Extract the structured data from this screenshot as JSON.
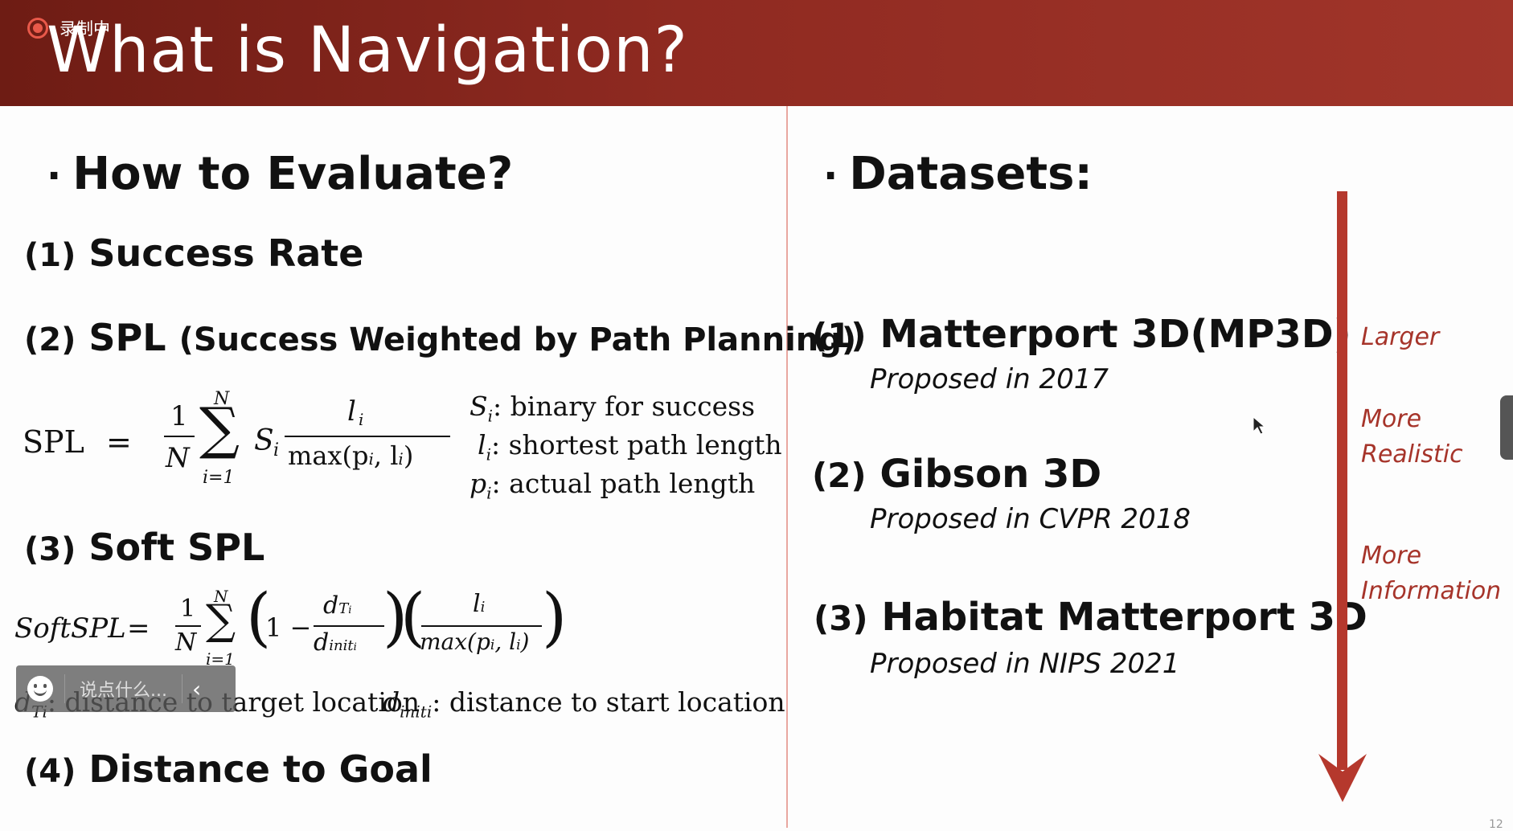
{
  "recording": {
    "label": "录制中"
  },
  "slide": {
    "title": "What is Navigation?",
    "left": {
      "heading": "How to Evaluate?",
      "items": [
        {
          "num": "(1)",
          "label": "Success Rate"
        },
        {
          "num": "(2)",
          "label": "SPL",
          "sub": "(Success Weighted by Path Planning)"
        },
        {
          "num": "(3)",
          "label": "Soft SPL"
        },
        {
          "num": "(4)",
          "label": "Distance to Goal"
        }
      ],
      "spl_formula": {
        "lhs": "SPL",
        "eq": "=",
        "one": "1",
        "N": "N",
        "sum_top": "N",
        "sum_bottom": "i=1",
        "S": "S",
        "i": "i",
        "num": "l",
        "den": "max(p",
        "den2": ", l",
        "den3": ")"
      },
      "spl_legend": [
        {
          "sym": "S",
          "sub": "i",
          "text": ": binary for success"
        },
        {
          "sym": "l",
          "sub": "i",
          "text": ": shortest path length"
        },
        {
          "sym": "p",
          "sub": "i",
          "text": ": actual path length"
        }
      ],
      "softspl_formula": {
        "lhs": "SoftSPL",
        "eq": "=",
        "one": "1",
        "N": "N",
        "sum_top": "N",
        "sum_bottom": "i=1",
        "minus": "1 −",
        "d_top": "d",
        "d_top_sub": "T",
        "d_top_subsub": "i",
        "d_bot": "d",
        "d_bot_sub": "init",
        "d_bot_subsub": "i",
        "l": "l",
        "l_sub": "i",
        "max": "max(p",
        "max2": ", l",
        "max3": ")"
      },
      "softspl_legend": [
        {
          "sym": "d",
          "sub": "Ti",
          "text": ": distance to target location"
        },
        {
          "sym": "d",
          "sub": "initi",
          "text": ": distance to start location"
        }
      ]
    },
    "right": {
      "heading": "Datasets:",
      "datasets": [
        {
          "num": "(1)",
          "name": "Matterport 3D(MP3D)",
          "sub": "Proposed in 2017"
        },
        {
          "num": "(2)",
          "name": "Gibson 3D",
          "sub": "Proposed in CVPR 2018"
        },
        {
          "num": "(3)",
          "name": "Habitat Matterport 3D",
          "sub": "Proposed in NIPS 2021"
        }
      ],
      "arrow_labels": [
        {
          "lines": [
            "Larger"
          ]
        },
        {
          "lines": [
            "More",
            "Realistic"
          ]
        },
        {
          "lines": [
            "More",
            "Information"
          ]
        }
      ],
      "accent_color": "#b5382d"
    },
    "page_number": "12"
  },
  "chat": {
    "placeholder": "说点什么..."
  }
}
